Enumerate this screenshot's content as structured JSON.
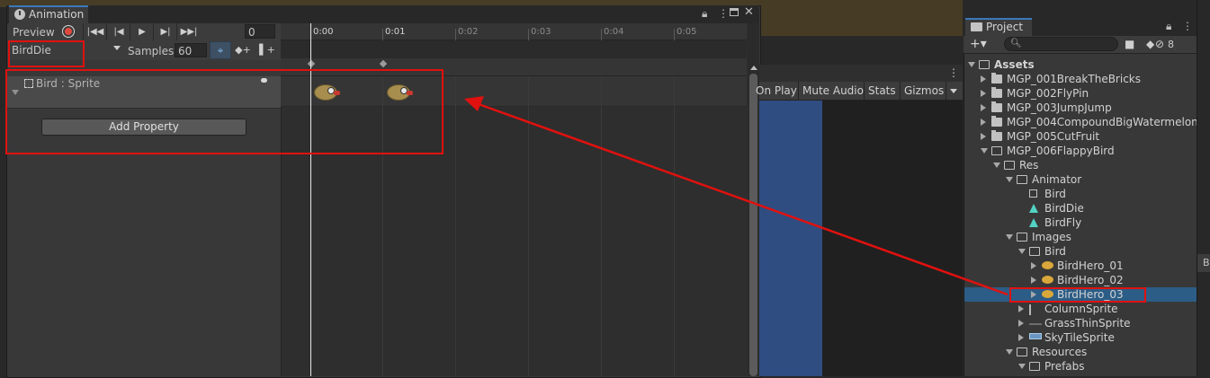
{
  "animation_window": {
    "title": "Animation",
    "preview_label": "Preview",
    "current_frame": "0",
    "clip_name": "BirdDie",
    "samples_label": "Samples",
    "samples_value": "60",
    "property_label": "Bird : Sprite",
    "add_property_label": "Add Property",
    "timeline_ticks": [
      "0:00",
      "0:01",
      "0:02",
      "0:03",
      "0:04",
      "0:05"
    ]
  },
  "scene_toolbar": {
    "items": [
      "On Play",
      "Mute Audio",
      "Stats",
      "Gizmos"
    ]
  },
  "project_window": {
    "title": "Project",
    "hidden_count": "8",
    "tree": [
      {
        "label": "Assets",
        "depth": 0,
        "icon": "folder-open",
        "expanded": true
      },
      {
        "label": "MGP_001BreakTheBricks",
        "depth": 1,
        "icon": "folder",
        "expanded": false
      },
      {
        "label": "MGP_002FlyPin",
        "depth": 1,
        "icon": "folder",
        "expanded": false
      },
      {
        "label": "MGP_003JumpJump",
        "depth": 1,
        "icon": "folder",
        "expanded": false
      },
      {
        "label": "MGP_004CompoundBigWatermelon",
        "depth": 1,
        "icon": "folder",
        "expanded": false
      },
      {
        "label": "MGP_005CutFruit",
        "depth": 1,
        "icon": "folder",
        "expanded": false
      },
      {
        "label": "MGP_006FlappyBird",
        "depth": 1,
        "icon": "folder-open",
        "expanded": true
      },
      {
        "label": "Res",
        "depth": 2,
        "icon": "folder-open",
        "expanded": true
      },
      {
        "label": "Animator",
        "depth": 3,
        "icon": "folder-open",
        "expanded": true
      },
      {
        "label": "Bird",
        "depth": 4,
        "icon": "controller"
      },
      {
        "label": "BirdDie",
        "depth": 4,
        "icon": "anim"
      },
      {
        "label": "BirdFly",
        "depth": 4,
        "icon": "anim"
      },
      {
        "label": "Images",
        "depth": 3,
        "icon": "folder-open",
        "expanded": true
      },
      {
        "label": "Bird",
        "depth": 4,
        "icon": "folder-open",
        "expanded": true
      },
      {
        "label": "BirdHero_01",
        "depth": 5,
        "icon": "bird",
        "expanded": false
      },
      {
        "label": "BirdHero_02",
        "depth": 5,
        "icon": "bird",
        "expanded": false
      },
      {
        "label": "BirdHero_03",
        "depth": 5,
        "icon": "bird",
        "expanded": false,
        "selected": true
      },
      {
        "label": "ColumnSprite",
        "depth": 4,
        "icon": "column",
        "expanded": false
      },
      {
        "label": "GrassThinSprite",
        "depth": 4,
        "icon": "grass",
        "expanded": false
      },
      {
        "label": "SkyTileSprite",
        "depth": 4,
        "icon": "sky",
        "expanded": false
      },
      {
        "label": "Resources",
        "depth": 3,
        "icon": "folder-open",
        "expanded": true
      },
      {
        "label": "Prefabs",
        "depth": 4,
        "icon": "folder-open",
        "expanded": true
      }
    ]
  },
  "right_strip_label": "B",
  "colors": {
    "annotation_red": "#e0110f",
    "selection_blue": "#2c5d87",
    "accent_blue": "#3a79bb"
  }
}
